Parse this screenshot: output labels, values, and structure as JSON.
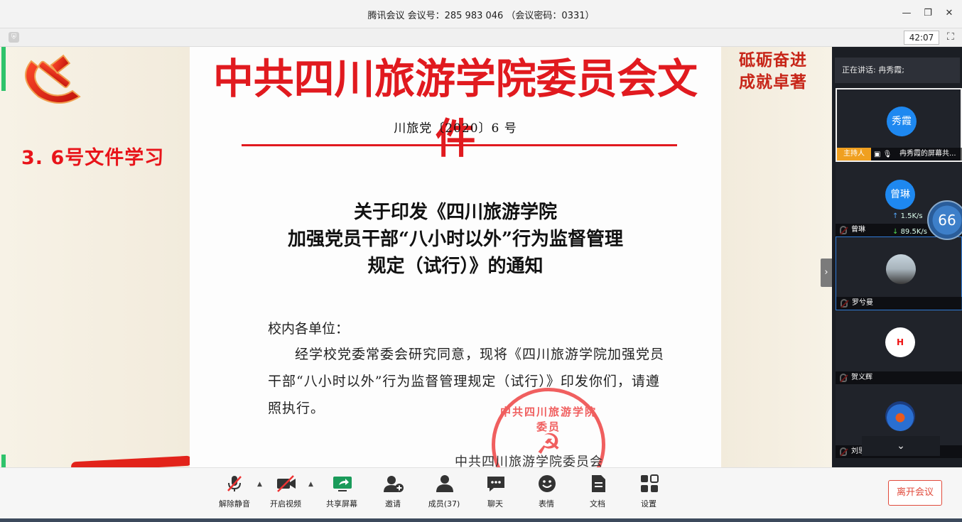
{
  "window": {
    "title": "腾讯会议 会议号：285 983 046 （会议密码：0331）",
    "minimize_icon": "minimize-icon",
    "restore_icon": "restore-icon",
    "close_icon": "close-icon"
  },
  "toolbar": {
    "timer": "42:07"
  },
  "slide": {
    "title": "3. 6号文件学习",
    "slogan_line1": "砥砺奋进",
    "slogan_line2": "成就卓著",
    "accent_color": "#e8141a"
  },
  "document": {
    "header": "中共四川旅游学院委员会文件",
    "number": "川旅党〔2020〕6 号",
    "subject_line1": "关于印发《四川旅游学院",
    "subject_line2": "加强党员干部“八小时以外”行为监督管理",
    "subject_line3": "规定（试行）》的通知",
    "salutation": "校内各单位：",
    "body": "经学校党委常委会研究同意，现将《四川旅游学院加强党员干部“八小时以外”行为监督管理规定（试行）》印发你们，请遵照执行。",
    "seal_text": "中共四川旅游学院委员",
    "issuer": "中共四川旅游学院委员会"
  },
  "sidebar": {
    "speaking": "正在讲话: 冉秀霞;",
    "host_tag": "主持人",
    "participants": [
      {
        "avatar_text": "秀霞",
        "name": "冉秀霞的屏幕共..."
      },
      {
        "avatar_text": "曾琳",
        "name": "曾琳"
      },
      {
        "avatar_text": "",
        "name": "罗兮曼"
      },
      {
        "avatar_text": "H",
        "name": "贺义辉"
      },
      {
        "avatar_text": "",
        "name": "刘思佳"
      }
    ],
    "network": {
      "upload": "1.5K/s",
      "download": "89.5K/s",
      "gauge": "66"
    }
  },
  "bottombar": {
    "buttons": [
      {
        "label": "解除静音",
        "icon": "muted-mic-icon"
      },
      {
        "label": "开启视频",
        "icon": "video-off-icon"
      },
      {
        "label": "共享屏幕",
        "icon": "share-screen-icon"
      },
      {
        "label": "邀请",
        "icon": "invite-icon"
      },
      {
        "label": "成员(37)",
        "icon": "members-icon"
      },
      {
        "label": "聊天",
        "icon": "chat-icon"
      },
      {
        "label": "表情",
        "icon": "emoji-icon"
      },
      {
        "label": "文档",
        "icon": "document-icon"
      },
      {
        "label": "设置",
        "icon": "settings-icon"
      }
    ],
    "leave": "离开会议"
  }
}
